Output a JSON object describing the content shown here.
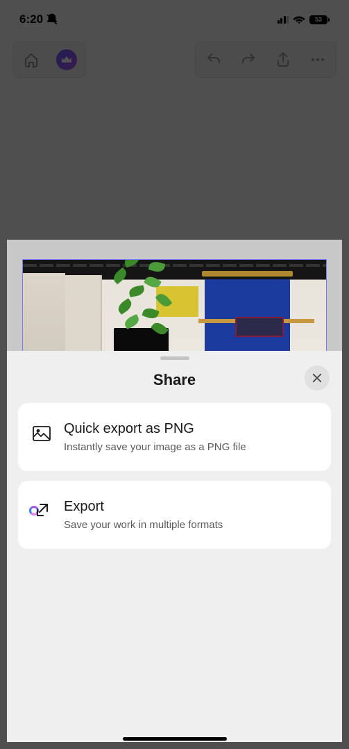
{
  "status": {
    "time": "6:20",
    "battery_level": "53"
  },
  "sheet": {
    "title": "Share",
    "options": [
      {
        "title": "Quick export as PNG",
        "subtitle": "Instantly save your image as a PNG file"
      },
      {
        "title": "Export",
        "subtitle": "Save your work in multiple formats"
      }
    ]
  }
}
